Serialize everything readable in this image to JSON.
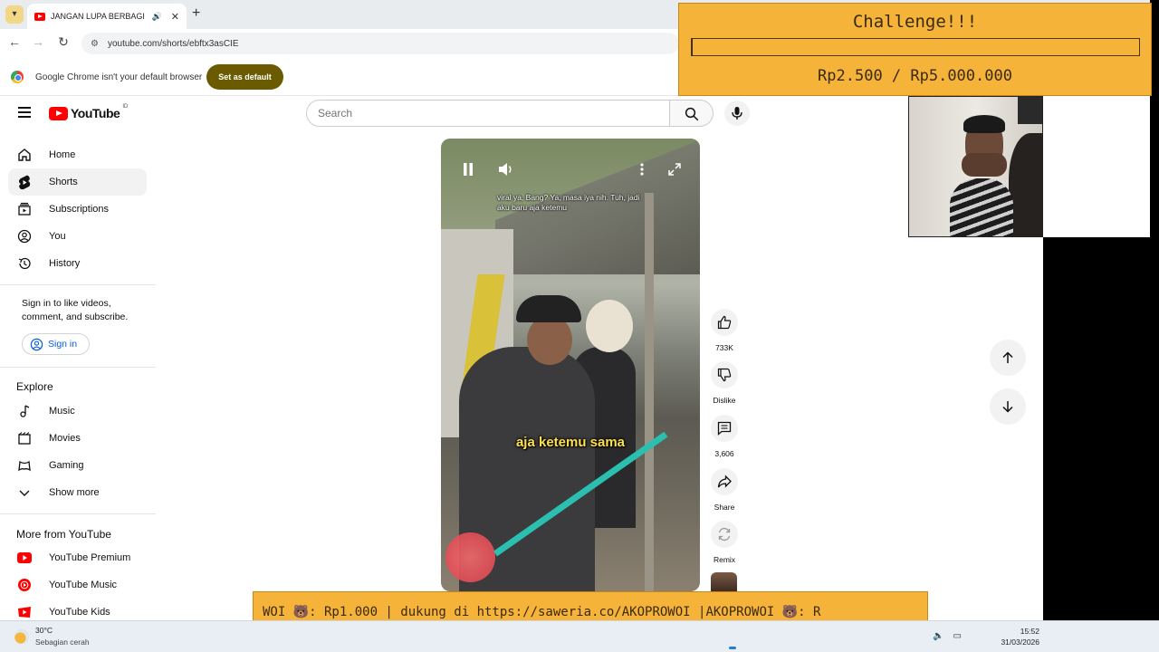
{
  "browser": {
    "tab_title": "JANGAN LUPA BERBAGI KE",
    "url": "youtube.com/shorts/ebftx3asCIE",
    "infobar_text": "Google Chrome isn't your default browser",
    "set_default_label": "Set as default"
  },
  "youtube": {
    "logo_text": "YouTube",
    "logo_country": "ID",
    "search_placeholder": "Search"
  },
  "sidebar": {
    "main": [
      {
        "label": "Home",
        "icon": "home-icon"
      },
      {
        "label": "Shorts",
        "icon": "shorts-icon",
        "active": true
      },
      {
        "label": "Subscriptions",
        "icon": "subscriptions-icon"
      },
      {
        "label": "You",
        "icon": "you-icon"
      },
      {
        "label": "History",
        "icon": "history-icon"
      }
    ],
    "signin_prompt": "Sign in to like videos, comment, and subscribe.",
    "signin_label": "Sign in",
    "explore_heading": "Explore",
    "explore": [
      {
        "label": "Music",
        "icon": "music-icon"
      },
      {
        "label": "Movies",
        "icon": "movies-icon"
      },
      {
        "label": "Gaming",
        "icon": "gaming-icon"
      },
      {
        "label": "Show more",
        "icon": "chevron-down-icon"
      }
    ],
    "more_heading": "More from YouTube",
    "more": [
      {
        "label": "YouTube Premium",
        "icon": "youtube-premium-icon"
      },
      {
        "label": "YouTube Music",
        "icon": "youtube-music-icon"
      },
      {
        "label": "YouTube Kids",
        "icon": "youtube-kids-icon"
      }
    ]
  },
  "video": {
    "caption_top": "viral ya, Bang? Ya, masa iya nih. Tuh, jadi aku baru aja ketemu",
    "caption_mid": "aja ketemu sama"
  },
  "actions": {
    "like_count": "733K",
    "dislike_label": "Dislike",
    "comment_count": "3,606",
    "share_label": "Share",
    "remix_label": "Remix"
  },
  "overlay": {
    "challenge_title": "Challenge!!!",
    "challenge_amount": "Rp2.500 / Rp5.000.000",
    "challenge_progress": 0.0005,
    "ticker_text": "WOI 🐻: Rp1.000 |  dukung di https://saweria.co/AKOPROWOI |AKOPROWOI 🐻: R"
  },
  "taskbar": {
    "temperature": "30°C",
    "weather": "Sebagian cerah",
    "time": "15:52",
    "date": "31/03/2026"
  },
  "colors": {
    "youtube_red": "#ff0000",
    "overlay_orange": "#f6b33a",
    "set_default_bg": "#6b5b00",
    "signin_blue": "#065fd4"
  }
}
